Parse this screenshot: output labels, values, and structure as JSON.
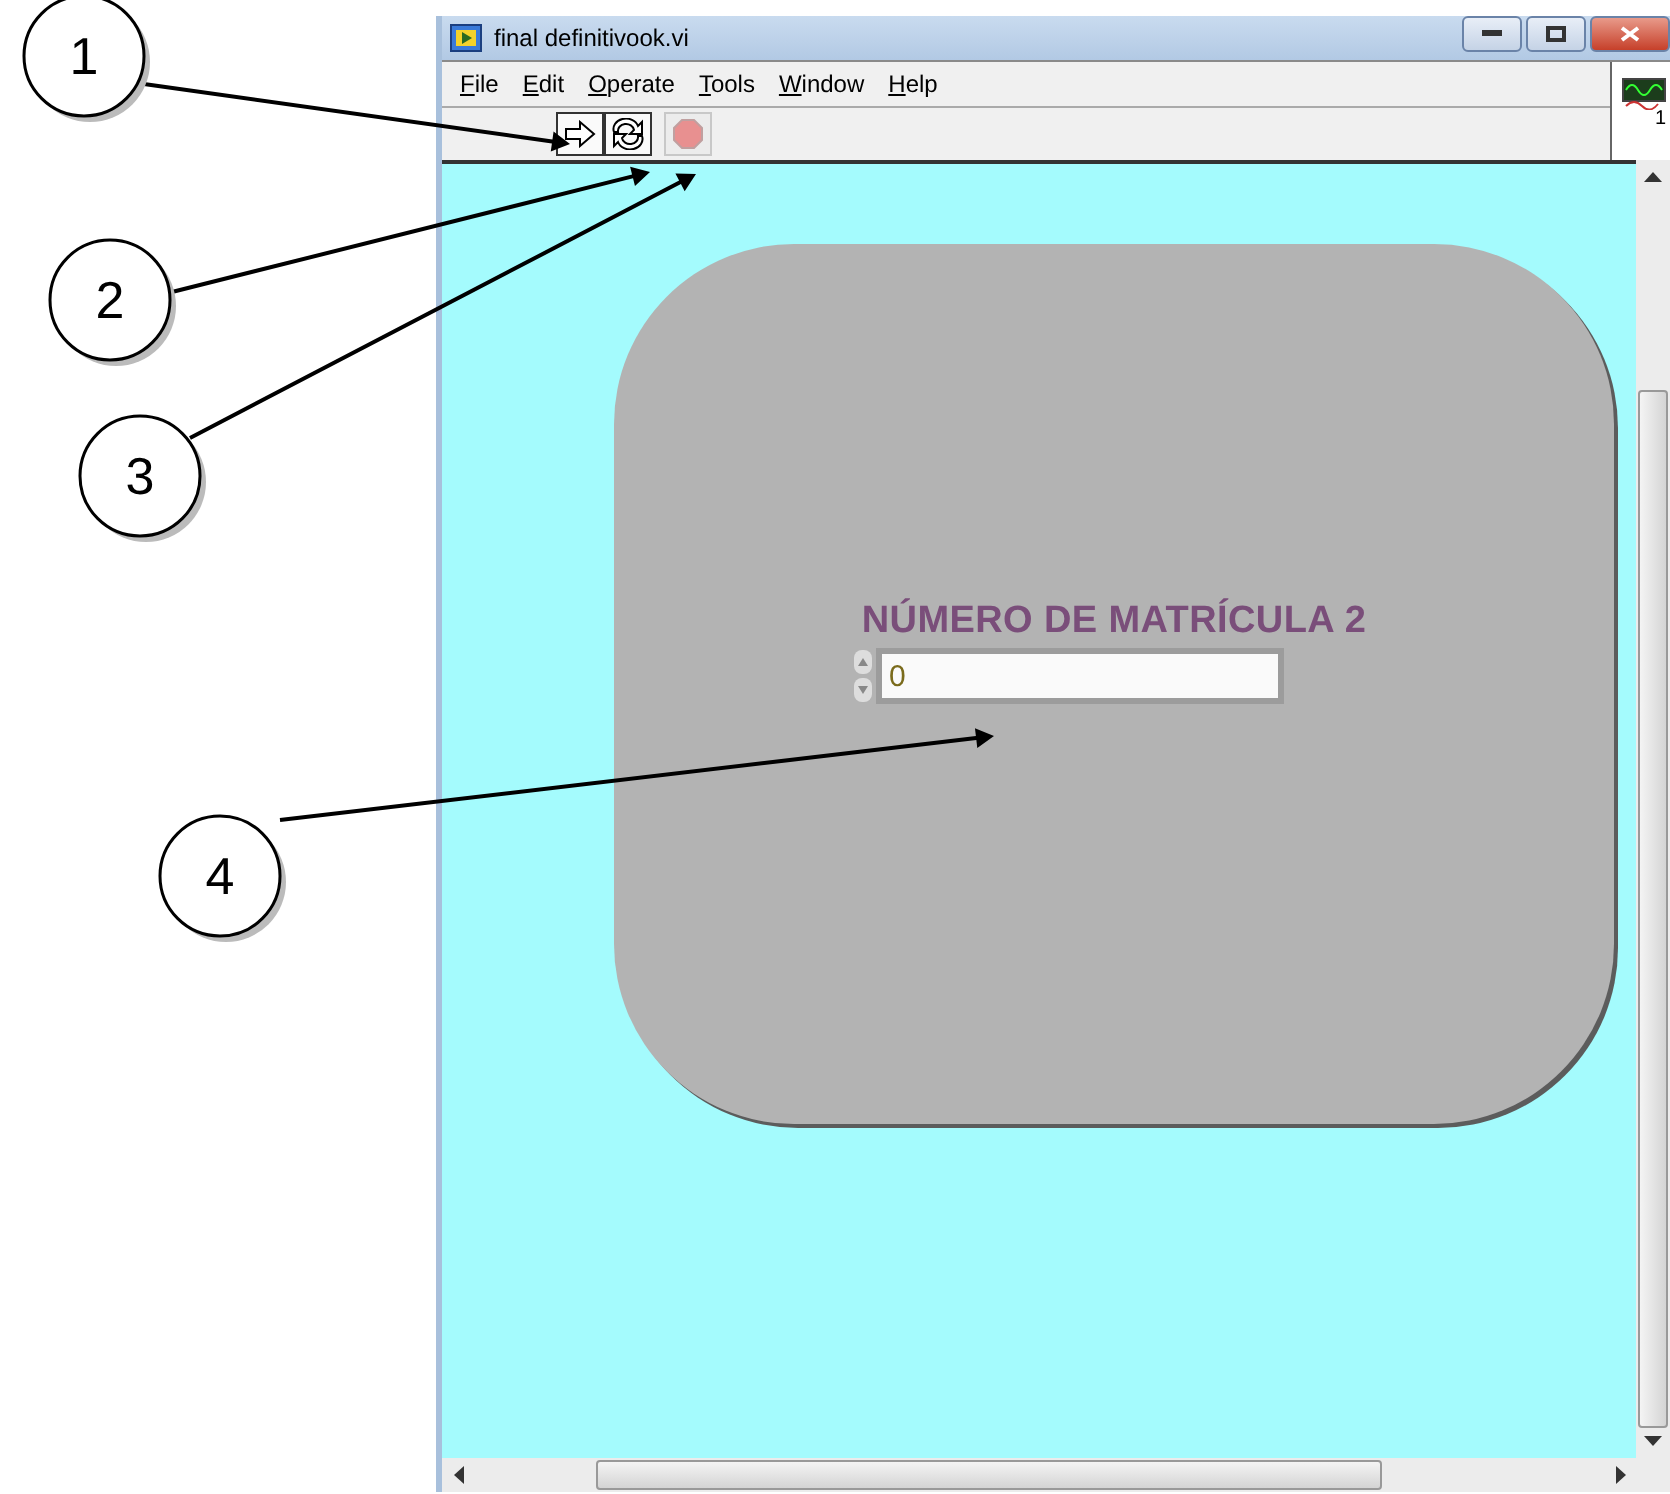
{
  "window": {
    "title": "final definitivook.vi"
  },
  "menu": [
    "File",
    "Edit",
    "Operate",
    "Tools",
    "Window",
    "Help"
  ],
  "toolbar": [
    {
      "kind": "run",
      "disabled": false
    },
    {
      "kind": "run-continuously",
      "disabled": false
    },
    {
      "kind": "abort",
      "disabled": true
    }
  ],
  "icon_pane": {
    "text": "1"
  },
  "control": {
    "label": "NÚMERO DE MATRÍCULA 2",
    "value": "0"
  },
  "callouts": [
    "1",
    "2",
    "3",
    "4"
  ]
}
